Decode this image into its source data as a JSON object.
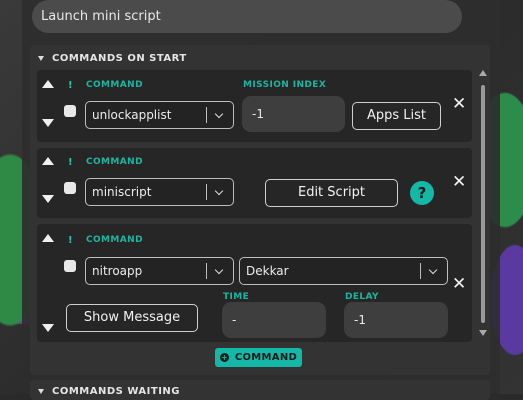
{
  "top_input": {
    "value": "Launch mini script"
  },
  "section_start": {
    "title": "COMMANDS ON START"
  },
  "section_waiting": {
    "title": "COMMANDS WAITING"
  },
  "cards": [
    {
      "command_label": "COMMAND",
      "command_value": "unlockapplist",
      "mission_label": "MISSION INDEX",
      "mission_value": "-1",
      "button_label": "Apps List"
    },
    {
      "command_label": "COMMAND",
      "command_value": "miniscript",
      "button_label": "Edit Script",
      "help": "?"
    },
    {
      "command_label": "COMMAND",
      "command_value": "nitroapp",
      "target_value": "Dekkar",
      "button_label": "Show Message",
      "time_label": "TIME",
      "time_value": "-",
      "delay_label": "DELAY",
      "delay_value": "-1"
    }
  ],
  "add_command": {
    "label": "COMMAND",
    "icon": "plus-icon"
  },
  "icons": {
    "exclamation": "!",
    "close": "✕"
  },
  "colors": {
    "accent": "#14b8a6",
    "label": "#1eb5a0"
  }
}
